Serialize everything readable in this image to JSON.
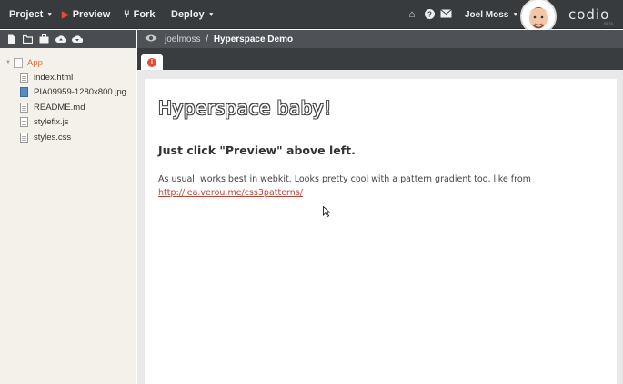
{
  "topbar": {
    "menus": {
      "project": "Project",
      "preview": "Preview",
      "fork": "Fork",
      "deploy": "Deploy"
    },
    "user_name": "Joel Moss",
    "logo": "codio",
    "logo_sub": "BETA"
  },
  "sidebar": {
    "toolbar_icons": [
      "new-file-icon",
      "open-folder-icon",
      "briefcase-icon",
      "cloud-upload-icon",
      "cloud-download-icon"
    ],
    "tree": {
      "root": "App",
      "files": [
        "index.html",
        "PIA09959-1280x800.jpg",
        "README.md",
        "stylefix.js",
        "styles.css"
      ]
    }
  },
  "editor": {
    "breadcrumb_user": "joelmoss",
    "breadcrumb_sep": "/",
    "breadcrumb_project": "Hyperspace Demo",
    "tab_icon": "i"
  },
  "content": {
    "heading": "Hyperspace baby!",
    "subheading": "Just click \"Preview\" above left.",
    "paragraph": "As usual, works best in webkit. Looks pretty cool with a pattern gradient too, like from",
    "link": "http://lea.verou.me/css3patterns/"
  }
}
